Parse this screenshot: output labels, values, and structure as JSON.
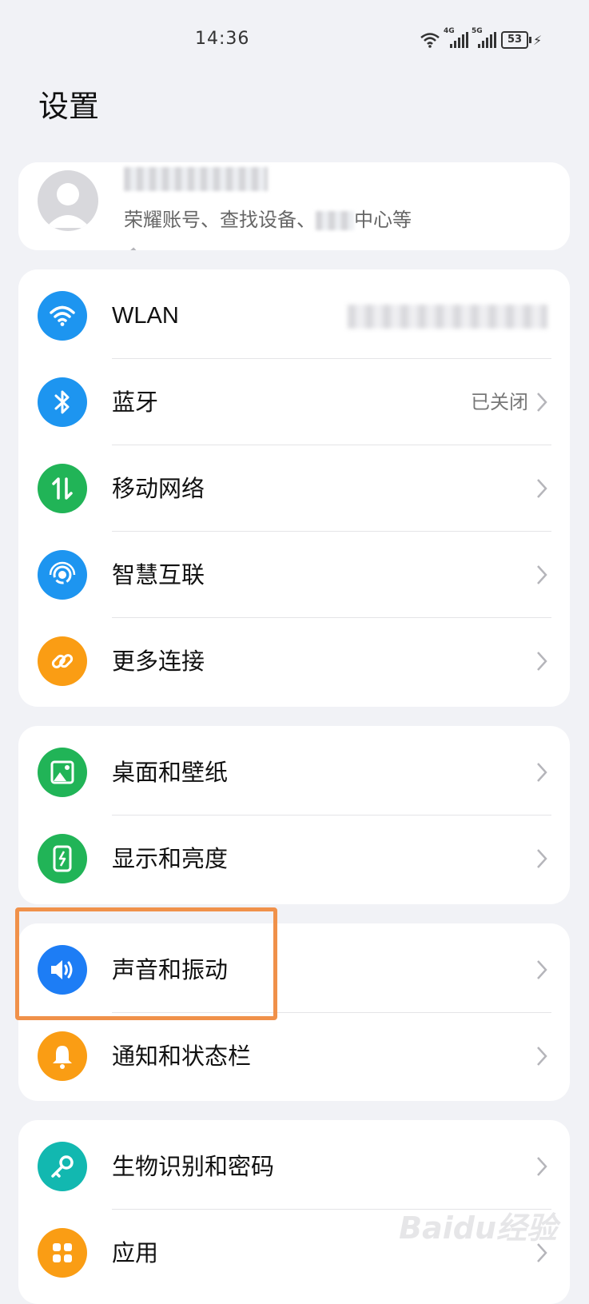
{
  "status_bar": {
    "time": "14:36",
    "network_1": "4G",
    "network_2": "5G",
    "battery": "53"
  },
  "page_title": "设置",
  "account": {
    "subtitle_prefix": "荣耀账号、查找设备、",
    "subtitle_suffix": "中心等"
  },
  "connectivity": [
    {
      "label": "WLAN",
      "icon": "wifi-icon",
      "color": "#1d95f0"
    },
    {
      "label": "蓝牙",
      "value": "已关闭",
      "icon": "bluetooth-icon",
      "color": "#1d95f0"
    },
    {
      "label": "移动网络",
      "icon": "mobile-data-icon",
      "color": "#21b457"
    },
    {
      "label": "智慧互联",
      "icon": "smart-connect-icon",
      "color": "#1d95f0"
    },
    {
      "label": "更多连接",
      "icon": "link-icon",
      "color": "#fa9d14"
    }
  ],
  "display": [
    {
      "label": "桌面和壁纸",
      "icon": "wallpaper-icon",
      "color": "#21b457"
    },
    {
      "label": "显示和亮度",
      "icon": "brightness-icon",
      "color": "#21b457"
    }
  ],
  "sound": [
    {
      "label": "声音和振动",
      "icon": "speaker-icon",
      "color": "#1d7df5"
    },
    {
      "label": "通知和状态栏",
      "icon": "bell-icon",
      "color": "#fa9d14"
    }
  ],
  "security": [
    {
      "label": "生物识别和密码",
      "icon": "key-icon",
      "color": "#12b8b0"
    },
    {
      "label": "应用",
      "icon": "apps-icon",
      "color": "#fa9d14"
    }
  ],
  "watermark": "Baidu经验"
}
